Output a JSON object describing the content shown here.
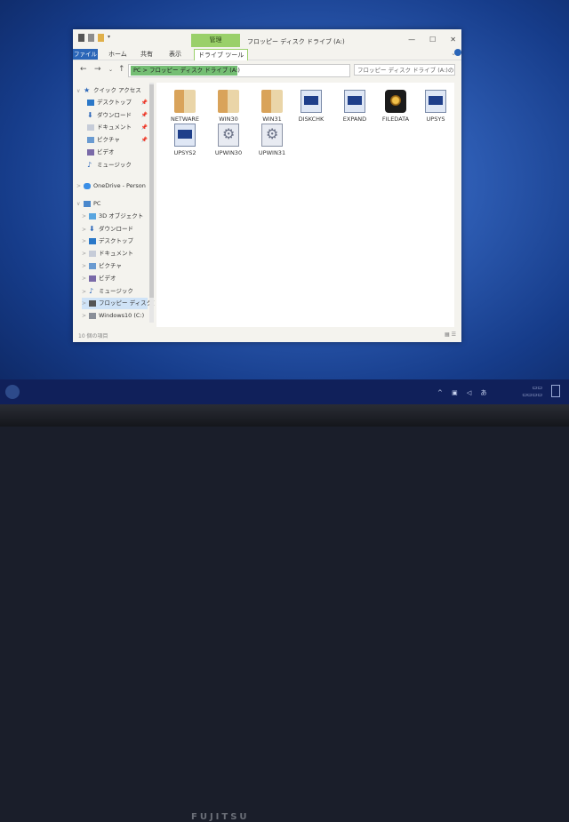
{
  "window": {
    "context_tab": "管理",
    "title": "フロッピー ディスク ドライブ (A:)",
    "controls": [
      "—",
      "☐",
      "✕"
    ]
  },
  "ribbon": {
    "tabs": [
      "ファイル",
      "ホーム",
      "共有",
      "表示",
      "ドライブ ツール"
    ]
  },
  "address": {
    "path": "PC > フロッピー ディスク ドライブ (A:)",
    "search_placeholder": "フロッピー ディスク ドライブ (A:)の..."
  },
  "nav": {
    "items": [
      {
        "label": "クイック アクセス",
        "icon": "star-icon",
        "pinned": false
      },
      {
        "label": "デスクトップ",
        "icon": "desktop-icon",
        "pinned": true
      },
      {
        "label": "ダウンロード",
        "icon": "download-icon",
        "pinned": true
      },
      {
        "label": "ドキュメント",
        "icon": "document-icon",
        "pinned": true
      },
      {
        "label": "ピクチャ",
        "icon": "picture-icon",
        "pinned": true
      },
      {
        "label": "ビデオ",
        "icon": "video-icon",
        "pinned": false
      },
      {
        "label": "ミュージック",
        "icon": "music-icon",
        "pinned": false
      },
      {
        "label": "OneDrive - Person",
        "icon": "cloud-icon",
        "pinned": false
      },
      {
        "label": "PC",
        "icon": "pc-icon",
        "pinned": false
      },
      {
        "label": "3D オブジェクト",
        "icon": "cube-icon",
        "pinned": false
      },
      {
        "label": "ダウンロード",
        "icon": "download-icon",
        "pinned": false
      },
      {
        "label": "デスクトップ",
        "icon": "desktop-icon",
        "pinned": false
      },
      {
        "label": "ドキュメント",
        "icon": "document-icon",
        "pinned": false
      },
      {
        "label": "ピクチャ",
        "icon": "picture-icon",
        "pinned": false
      },
      {
        "label": "ビデオ",
        "icon": "video-icon",
        "pinned": false
      },
      {
        "label": "ミュージック",
        "icon": "music-icon",
        "pinned": false
      },
      {
        "label": "フロッピー ディスク ]",
        "icon": "floppy-icon",
        "pinned": false
      },
      {
        "label": "Windows10 (C:)",
        "icon": "drive-icon",
        "pinned": false
      }
    ]
  },
  "files": [
    {
      "name": "NETWARE",
      "type": "folder"
    },
    {
      "name": "WIN30",
      "type": "folder"
    },
    {
      "name": "WIN31",
      "type": "folder"
    },
    {
      "name": "DISKCHK",
      "type": "exe"
    },
    {
      "name": "EXPAND",
      "type": "exe"
    },
    {
      "name": "FILEDATA",
      "type": "app"
    },
    {
      "name": "UPSYS",
      "type": "exe"
    },
    {
      "name": "UPSYS2",
      "type": "exe"
    },
    {
      "name": "UPWIN30",
      "type": "gear"
    },
    {
      "name": "UPWIN31",
      "type": "gear"
    }
  ],
  "status": {
    "count": "10 個の項目"
  },
  "brand": "FUJITSU",
  "colors": {
    "accent": "#2b66b8",
    "context": "#9ad06a",
    "desktop": "#2e5db4"
  }
}
